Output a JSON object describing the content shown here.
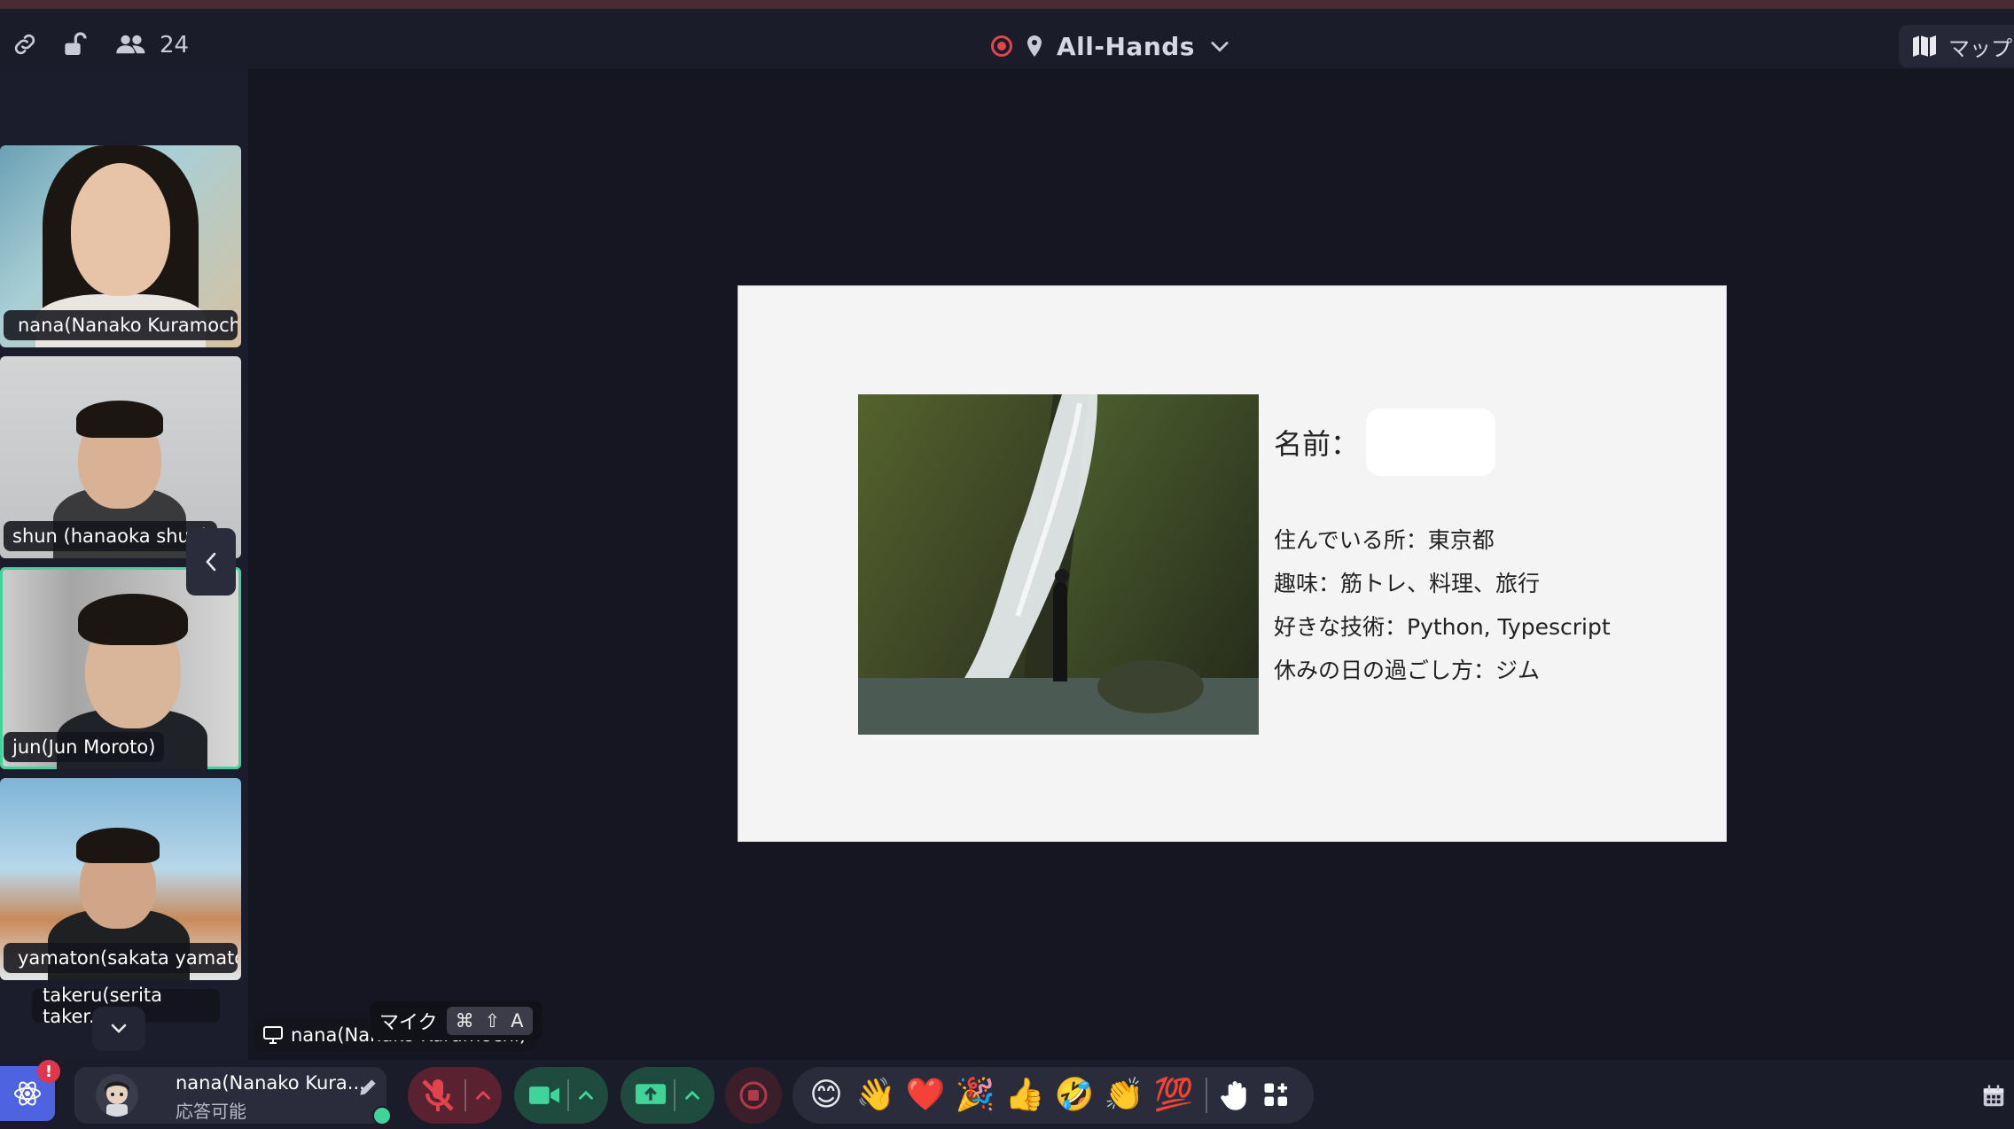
{
  "topbar": {
    "participant_count": "24",
    "room_name": "All-Hands",
    "map_label": "マップ"
  },
  "participants": [
    {
      "name": "nana(Nanako Kuramochi)",
      "muted": true
    },
    {
      "name": "shun (hanaoka shun)",
      "muted": false
    },
    {
      "name": "jun(Jun Moroto)",
      "muted": false,
      "active": true
    },
    {
      "name": "yamaton(sakata yamato)",
      "muted": true
    }
  ],
  "more_participant": "takeru(serita taker...",
  "screen_share": {
    "label": "nana(Nanako Kuramochi)",
    "tooltip_text": "マイク",
    "tooltip_keys": [
      "⌘",
      "⇧",
      "A"
    ]
  },
  "slide": {
    "name_label": "名前：",
    "lines": [
      "住んでいる所：東京都",
      "趣味：筋トレ、料理、旅行",
      "好きな技術：Python, Typescript",
      "休みの日の過ごし方：ジム"
    ]
  },
  "bottombar": {
    "badge": "!",
    "user_name": "nana(Nanako Kura...",
    "user_status": "応答可能",
    "reactions": [
      "😊",
      "👋",
      "❤️",
      "🎉",
      "👍",
      "🤣",
      "👏",
      "💯"
    ]
  },
  "colors": {
    "accent": "#4d63e0",
    "active_border": "#3fd49a",
    "mic_off": "#e0454f",
    "camera": "#3fd49a",
    "record": "#e0454f"
  }
}
